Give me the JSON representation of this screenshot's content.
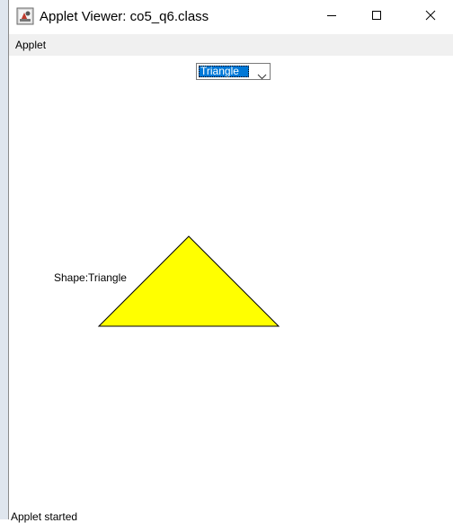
{
  "window": {
    "title": "Applet Viewer: co5_q6.class"
  },
  "menubar": {
    "items": [
      {
        "label": "Applet"
      }
    ]
  },
  "applet": {
    "shape_select": {
      "selected": "Triangle"
    },
    "shape_label": "Shape:Triangle",
    "shape_fill_color": "#ffff00",
    "shape_outline_color": "#000000"
  },
  "status_bar": {
    "text": "Applet started"
  },
  "icons": {
    "app": "java-applet-icon",
    "minimize": "minimize-icon",
    "maximize": "maximize-icon",
    "close": "close-icon",
    "dropdown": "chevron-down-icon"
  }
}
